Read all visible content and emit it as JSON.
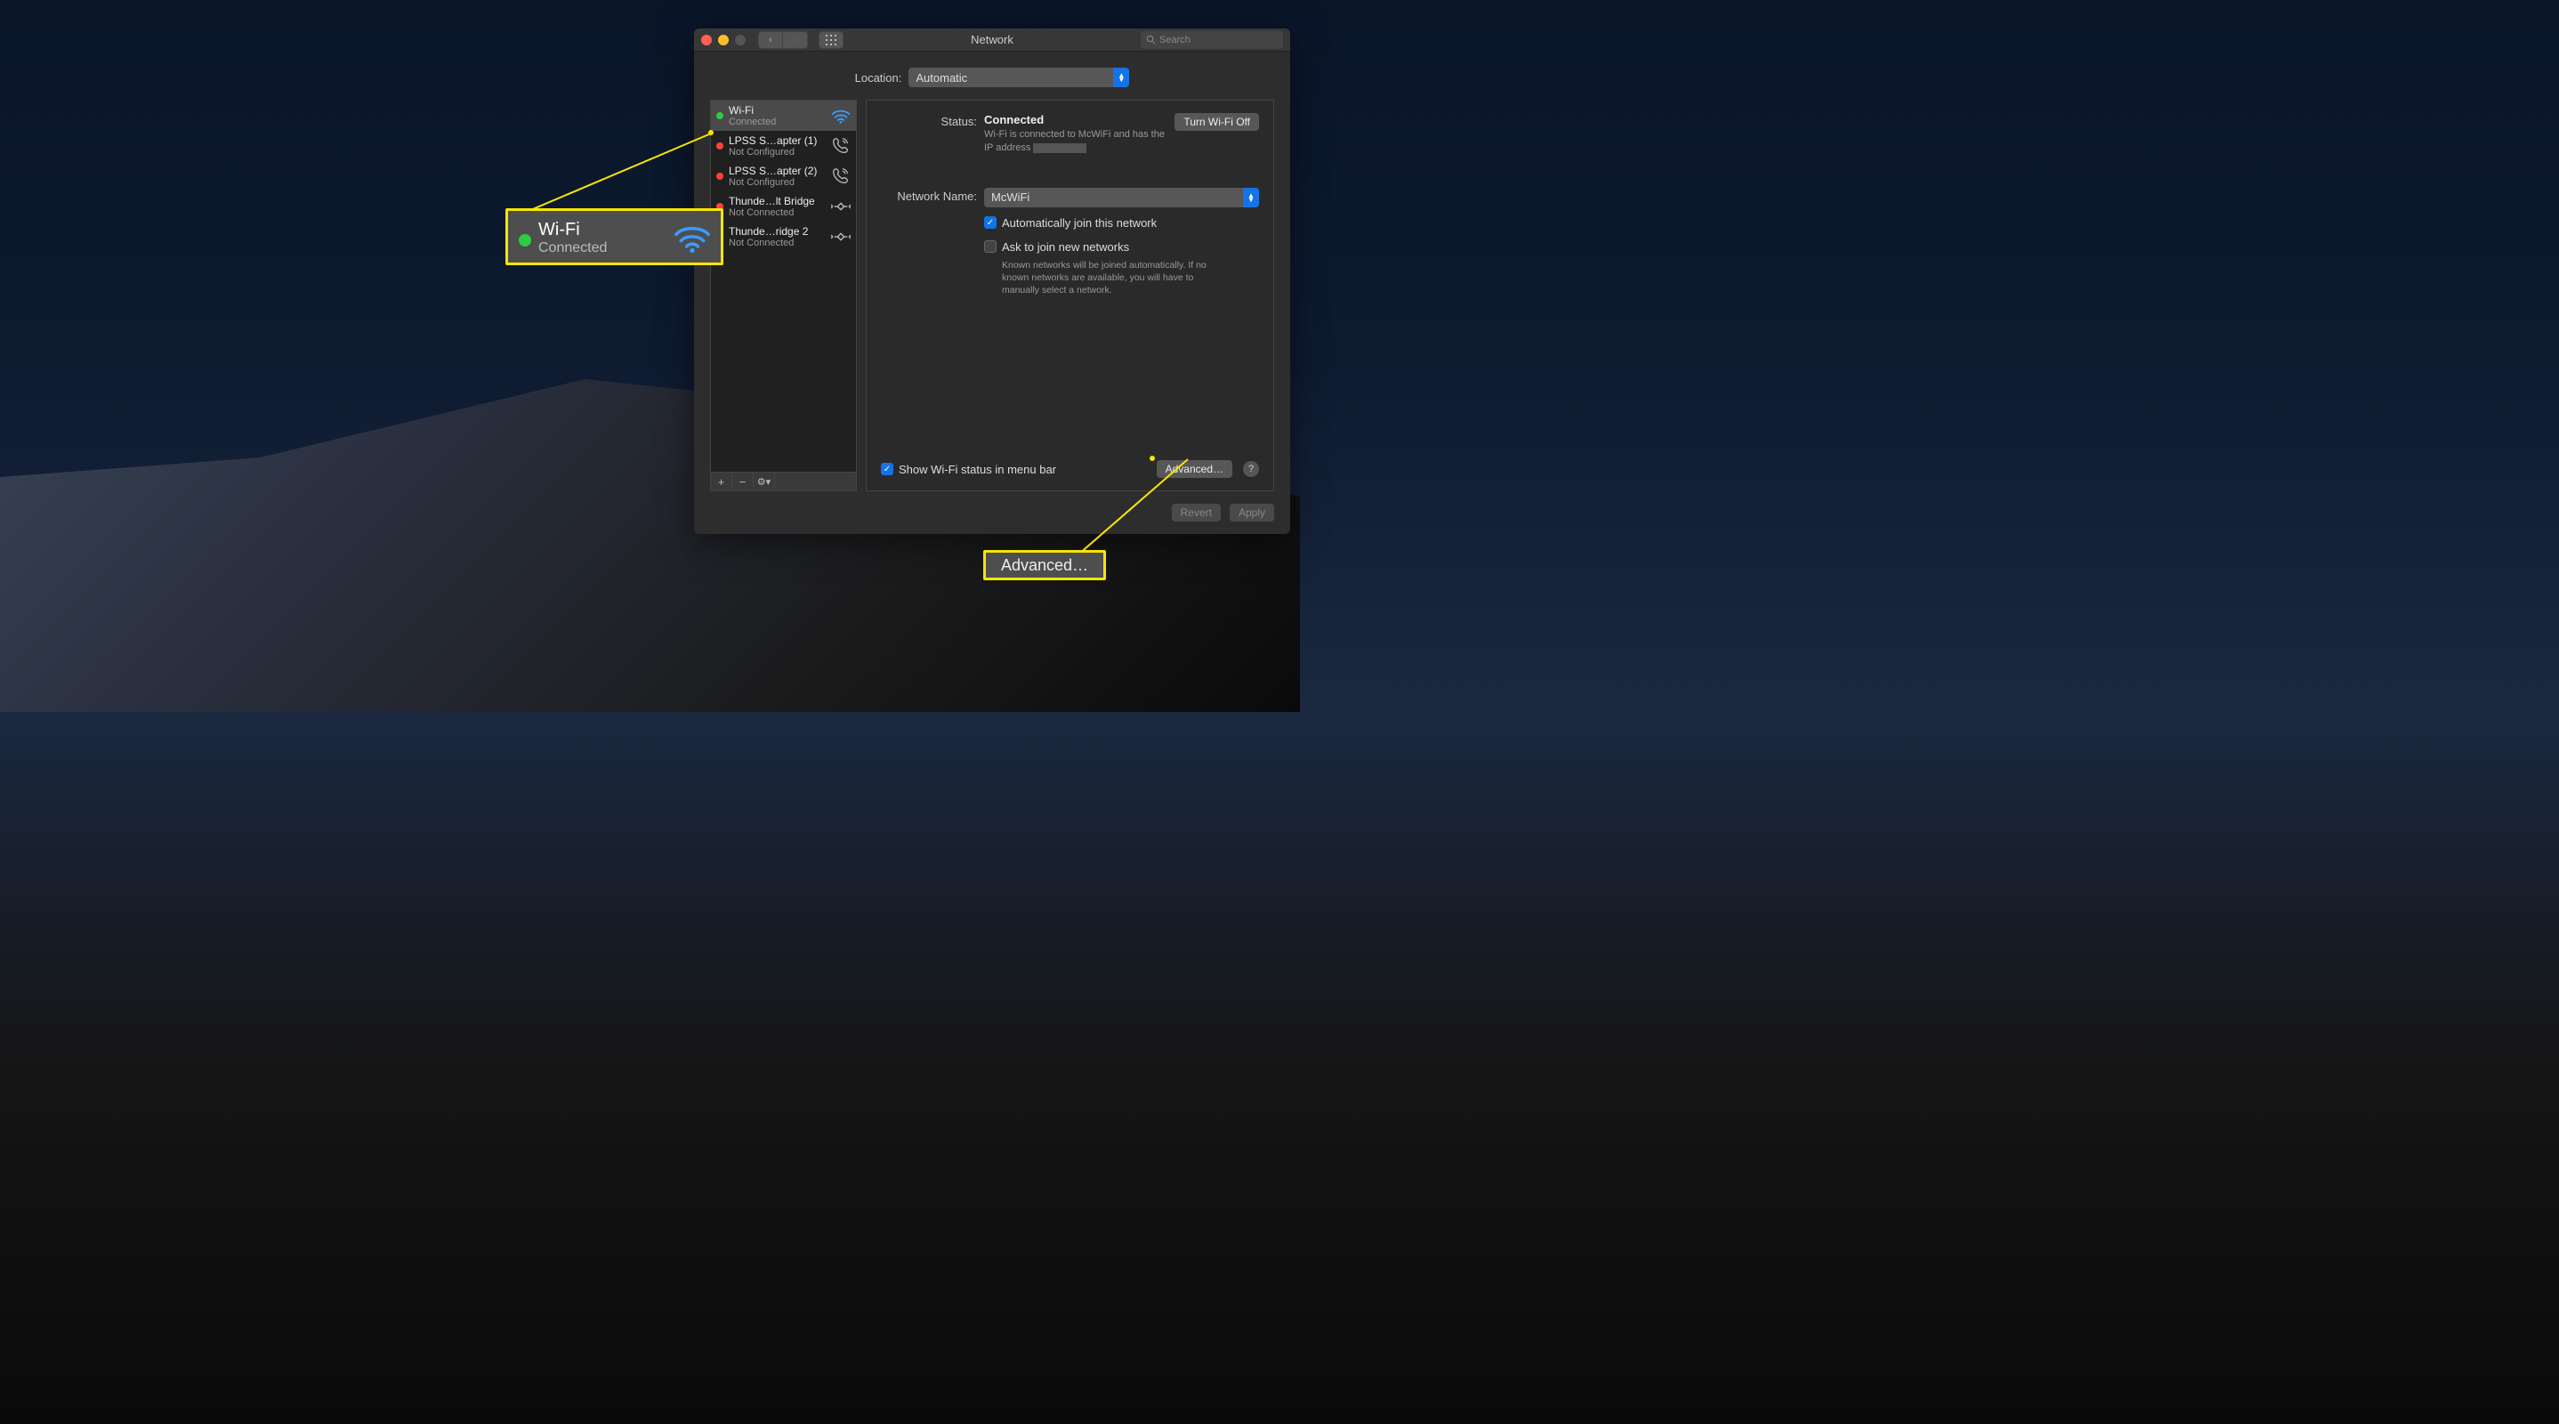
{
  "window": {
    "title": "Network",
    "search_placeholder": "Search"
  },
  "location": {
    "label": "Location:",
    "value": "Automatic"
  },
  "interfaces": [
    {
      "name": "Wi-Fi",
      "status": "Connected",
      "dot": "green",
      "icon": "wifi",
      "selected": true
    },
    {
      "name": "LPSS S…apter (1)",
      "status": "Not Configured",
      "dot": "red",
      "icon": "phone"
    },
    {
      "name": "LPSS S…apter (2)",
      "status": "Not Configured",
      "dot": "red",
      "icon": "phone"
    },
    {
      "name": "Thunde…lt Bridge",
      "status": "Not Connected",
      "dot": "red",
      "icon": "bridge"
    },
    {
      "name": "Thunde…ridge 2",
      "status": "Not Connected",
      "dot": "red",
      "icon": "bridge"
    }
  ],
  "sidebar_toolbar": {
    "add": "+",
    "remove": "−",
    "gear": "⚙︎▾"
  },
  "detail": {
    "status_label": "Status:",
    "status_value": "Connected",
    "wifi_off_btn": "Turn Wi-Fi Off",
    "status_sub": "Wi-Fi is connected to McWiFi and has the IP address",
    "network_label": "Network Name:",
    "network_value": "McWiFi",
    "auto_join": "Automatically join this network",
    "ask_join": "Ask to join new networks",
    "ask_help": "Known networks will be joined automatically. If no known networks are available, you will have to manually select a network.",
    "show_menu": "Show Wi-Fi status in menu bar",
    "advanced_btn": "Advanced…",
    "help": "?"
  },
  "footer": {
    "revert": "Revert",
    "apply": "Apply"
  },
  "callouts": {
    "wifi": {
      "name": "Wi-Fi",
      "status": "Connected"
    },
    "advanced": "Advanced…"
  }
}
